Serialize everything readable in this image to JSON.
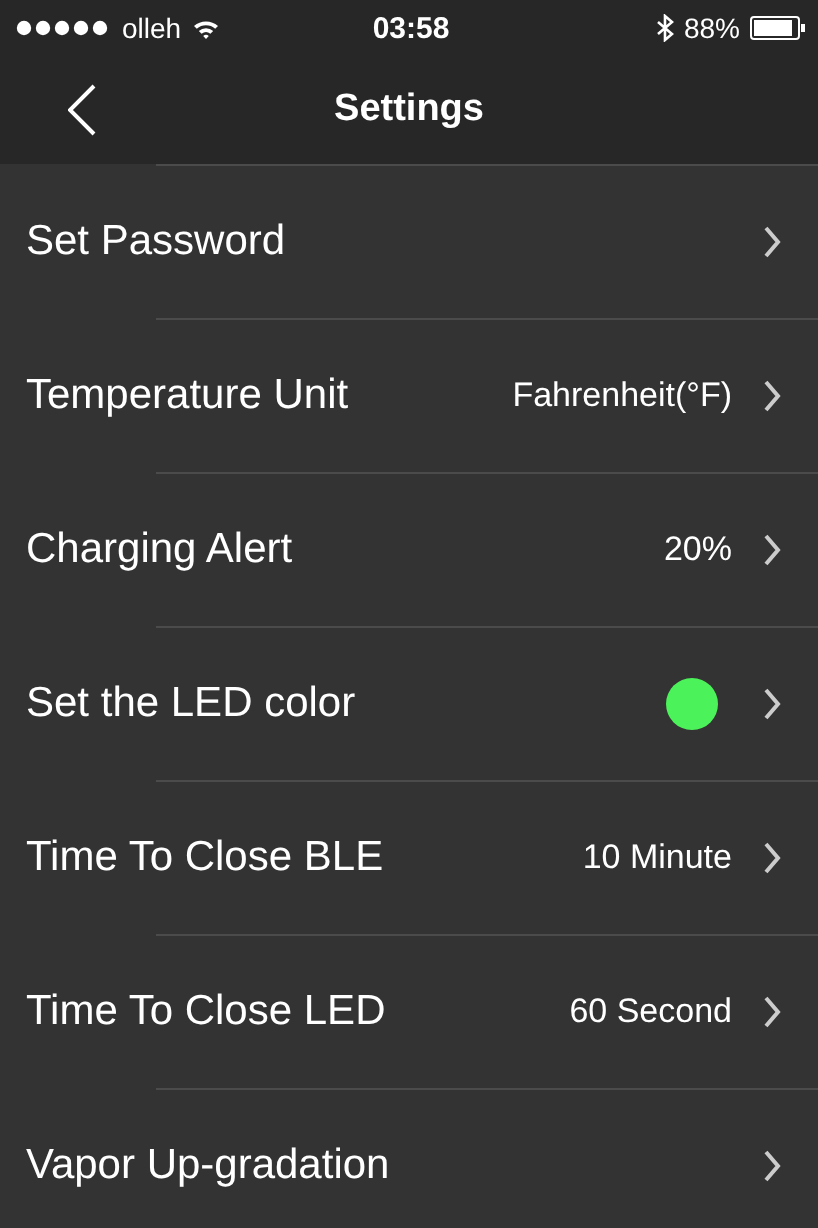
{
  "status_bar": {
    "carrier": "olleh",
    "time": "03:58",
    "battery": "88%"
  },
  "nav": {
    "title": "Settings"
  },
  "rows": [
    {
      "kind": "plain",
      "label": "Set Password"
    },
    {
      "kind": "value",
      "label": "Temperature Unit",
      "value": "Fahrenheit(°F)"
    },
    {
      "kind": "value",
      "label": "Charging Alert",
      "value": "20%"
    },
    {
      "kind": "color",
      "label": "Set the LED color",
      "color": "#4cf25a"
    },
    {
      "kind": "value",
      "label": "Time To Close BLE",
      "value": "10 Minute"
    },
    {
      "kind": "value",
      "label": "Time To Close LED",
      "value": "60 Second"
    },
    {
      "kind": "plain",
      "label": "Vapor Up-gradation"
    }
  ]
}
